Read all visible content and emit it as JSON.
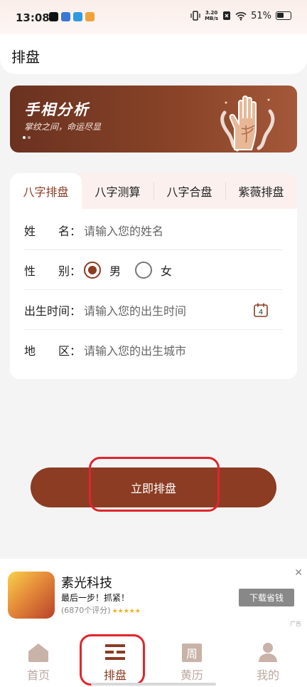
{
  "status": {
    "time": "13:08",
    "net_speed_value": "3.20",
    "net_speed_unit": "MB/s",
    "battery": "51%"
  },
  "header": {
    "title": "排盘"
  },
  "banner": {
    "title": "手相分析",
    "subtitle": "掌纹之间，命运尽显"
  },
  "tabs": [
    {
      "label": "八字排盘",
      "active": true
    },
    {
      "label": "八字测算"
    },
    {
      "label": "八字合盘"
    },
    {
      "label": "紫薇排盘"
    }
  ],
  "form": {
    "name": {
      "label": "姓　　名：",
      "placeholder": "请输入您的姓名"
    },
    "gender": {
      "label": "性　　别：",
      "options": [
        "男",
        "女"
      ],
      "selected": "男"
    },
    "birth_time": {
      "label": "出生时间：",
      "placeholder": "请输入您的出生时间",
      "calendar_day": "4"
    },
    "region": {
      "label": "地　　区：",
      "placeholder": "请输入您的出生城市"
    }
  },
  "submit": {
    "label": "立即排盘"
  },
  "ad": {
    "title": "素光科技",
    "desc": "最后一步！抓紧！",
    "rating": "(6870个评分)",
    "download": "下载省钱",
    "tag": "广告",
    "close": "✕"
  },
  "nav": [
    {
      "label": "首页",
      "icon": "home-icon"
    },
    {
      "label": "排盘",
      "icon": "paipan-icon",
      "active": true
    },
    {
      "label": "黄历",
      "icon": "week-calendar-icon",
      "icon_text": "周"
    },
    {
      "label": "我的",
      "icon": "user-icon"
    }
  ],
  "colors": {
    "accent": "#8b3c22",
    "highlight": "#e0252c",
    "nav_inactive": "#bba79f"
  }
}
